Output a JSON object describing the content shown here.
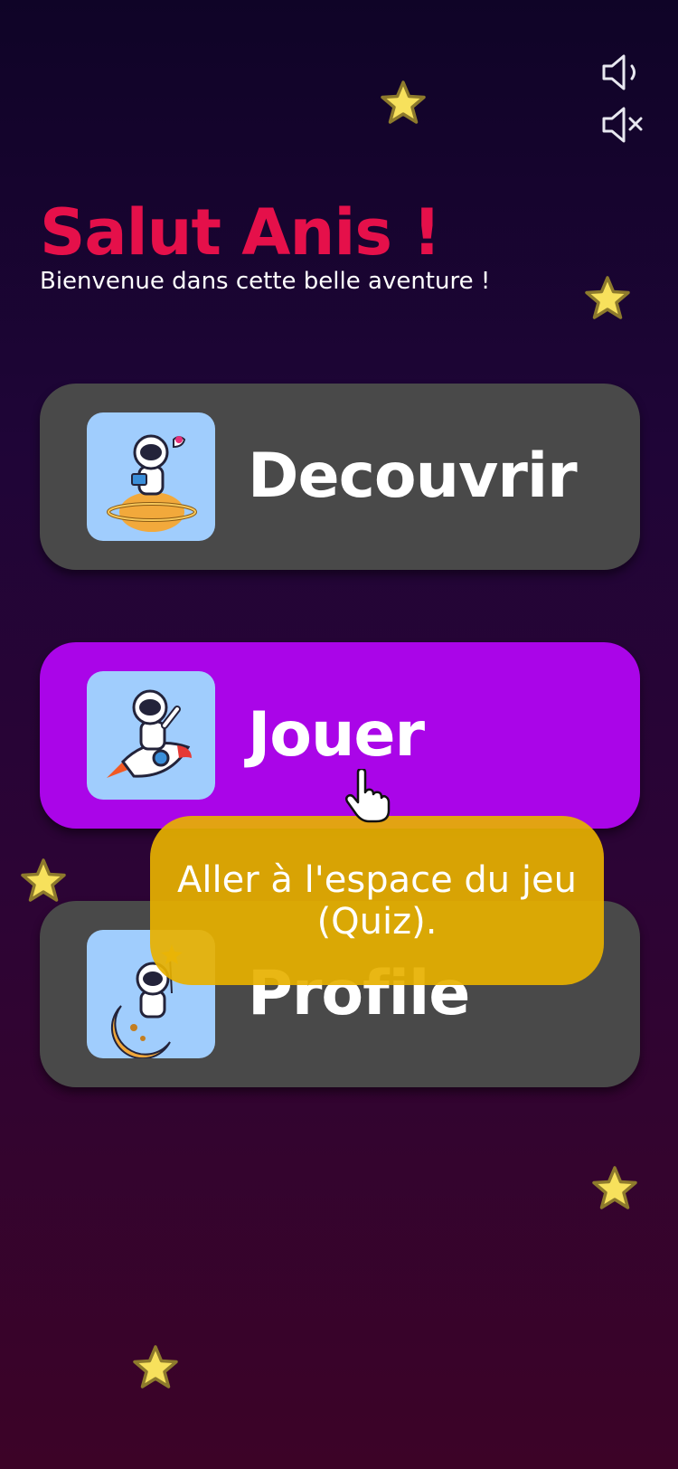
{
  "header": {
    "greeting": "Salut Anis !",
    "subtitle": "Bienvenue dans cette belle aventure !"
  },
  "sound_controls": {
    "sound_on_icon": "speaker-icon",
    "sound_off_icon": "speaker-mute-icon"
  },
  "menu": [
    {
      "label": "Decouvrir",
      "icon": "astronaut-on-planet",
      "color": "#494949"
    },
    {
      "label": "Jouer",
      "icon": "astronaut-on-rocket",
      "color": "#aa05e8"
    },
    {
      "label": "Profile",
      "icon": "astronaut-on-moon",
      "color": "#494949"
    }
  ],
  "tooltip": {
    "text": "Aller à l'espace du jeu (Quiz)."
  },
  "colors": {
    "accent": "#e5104a",
    "active_card": "#aa05e8",
    "card": "#494949",
    "tooltip": "#e7b100",
    "thumb_bg": "#a0cdfd",
    "star": "#f7e15c"
  }
}
